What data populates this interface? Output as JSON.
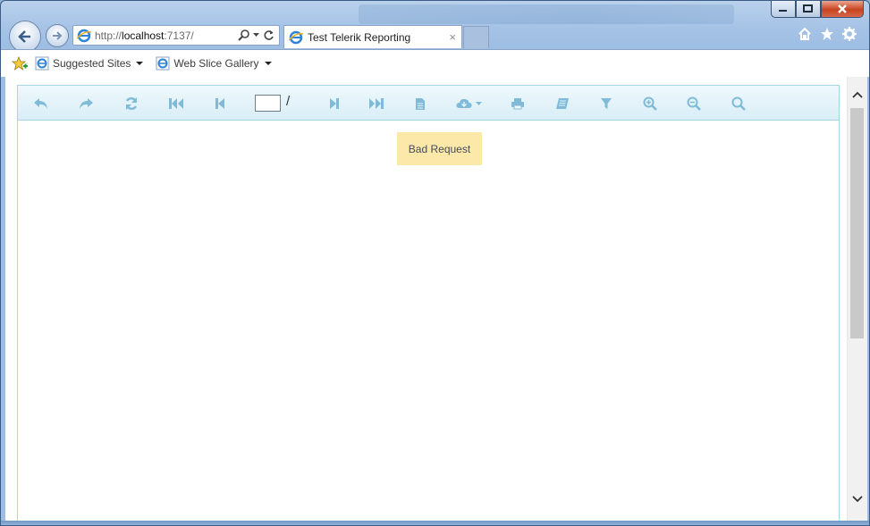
{
  "browser": {
    "address_url_prefix": "http://",
    "address_url_host": "localhost",
    "address_url_rest": ":7137/",
    "tab_title": "Test Telerik Reporting",
    "tab_close": "×"
  },
  "favorites": {
    "items": [
      {
        "label": "Suggested Sites"
      },
      {
        "label": "Web Slice Gallery"
      }
    ]
  },
  "viewer": {
    "page_input": "",
    "page_separator": "/",
    "message": "Bad Request",
    "toolbar_icons": [
      "back-icon",
      "forward-icon",
      "refresh-icon",
      "first-page-icon",
      "previous-page-icon",
      "next-page-icon",
      "last-page-icon",
      "document-map-icon",
      "export-icon",
      "print-icon",
      "print-preview-icon",
      "parameters-filter-icon",
      "zoom-in-icon",
      "zoom-out-icon",
      "search-icon"
    ]
  },
  "colors": {
    "toolbar_icon": "#7fbbd8",
    "message_bg": "#fce8a8",
    "viewer_border": "#a9d6e6"
  }
}
